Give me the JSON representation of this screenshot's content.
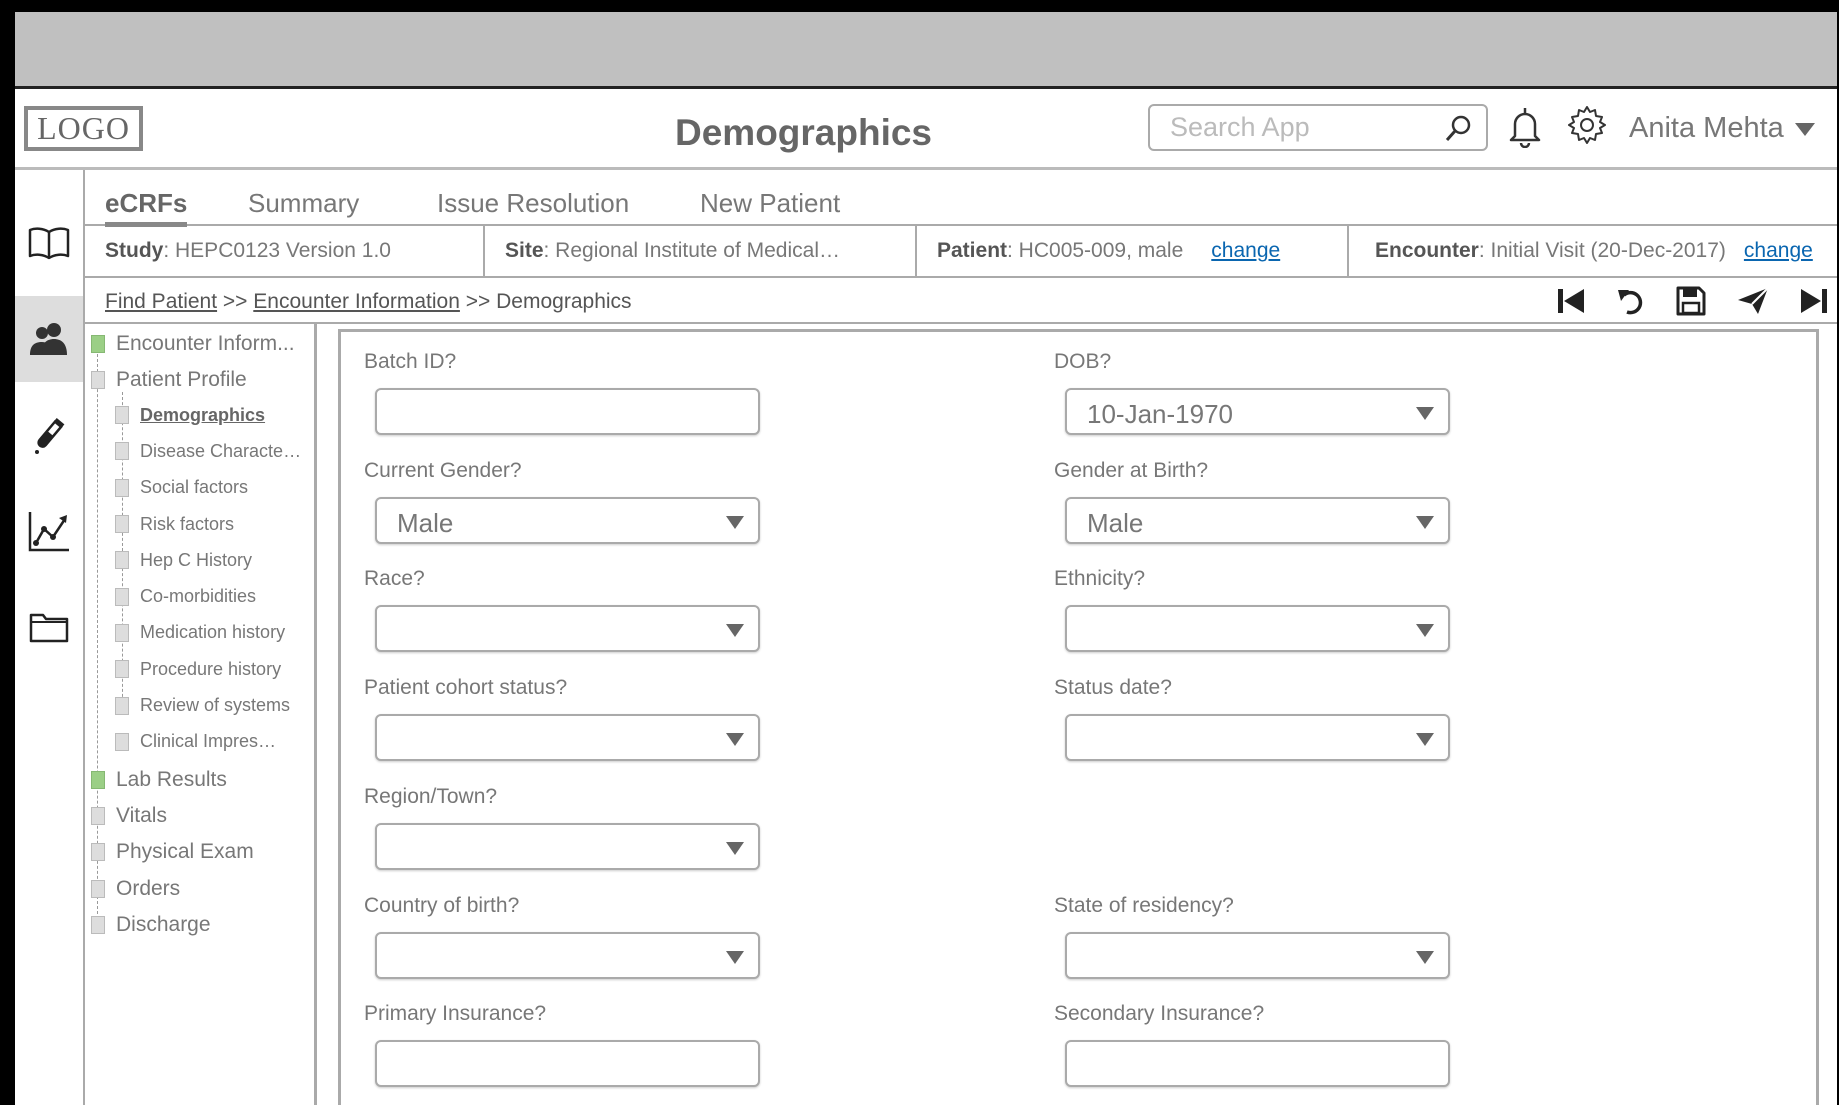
{
  "header": {
    "logo": "LOGO",
    "title": "Demographics",
    "search_placeholder": "Search App",
    "user_name": "Anita Mehta"
  },
  "rail": {
    "items": [
      "book-icon",
      "users-icon",
      "lab-flask-icon",
      "chart-icon",
      "folder-icon"
    ],
    "active": 1
  },
  "tabs": [
    {
      "label": "eCRFs",
      "active": true
    },
    {
      "label": "Summary",
      "active": false
    },
    {
      "label": "Issue Resolution",
      "active": false
    },
    {
      "label": "New Patient",
      "active": false
    }
  ],
  "context": {
    "study_label": "Study",
    "study_value": ": HEPC0123 Version 1.0",
    "site_label": "Site",
    "site_value": ": Regional Institute of Medical…",
    "patient_label": "Patient",
    "patient_value": ": HC005-009, male",
    "patient_change": "change",
    "encounter_label": "Encounter",
    "encounter_value": ": Initial Visit (20-Dec-2017)",
    "encounter_change": "change"
  },
  "breadcrumb": {
    "items": [
      "Find Patient",
      "Encounter Information",
      "Demographics"
    ],
    "separator": ">>"
  },
  "toolbar": [
    "skip-first-icon",
    "undo-icon",
    "save-icon",
    "send-icon",
    "skip-last-icon"
  ],
  "tree": {
    "items": [
      {
        "label": "Encounter Inform...",
        "level": 1,
        "status": "done"
      },
      {
        "label": "Patient Profile",
        "level": 1,
        "status": "none"
      },
      {
        "label": "Demographics",
        "level": 2,
        "status": "none",
        "current": true
      },
      {
        "label": "Disease Characte…",
        "level": 2,
        "status": "none"
      },
      {
        "label": "Social factors",
        "level": 2,
        "status": "none"
      },
      {
        "label": "Risk factors",
        "level": 2,
        "status": "none"
      },
      {
        "label": "Hep C History",
        "level": 2,
        "status": "none"
      },
      {
        "label": "Co-morbidities",
        "level": 2,
        "status": "none"
      },
      {
        "label": "Medication history",
        "level": 2,
        "status": "none"
      },
      {
        "label": "Procedure history",
        "level": 2,
        "status": "none"
      },
      {
        "label": "Review of systems",
        "level": 2,
        "status": "none"
      },
      {
        "label": "Clinical Impres…",
        "level": 2,
        "status": "none"
      },
      {
        "label": "Lab Results",
        "level": 1,
        "status": "done"
      },
      {
        "label": "Vitals",
        "level": 1,
        "status": "none"
      },
      {
        "label": "Physical Exam",
        "level": 1,
        "status": "none"
      },
      {
        "label": "Orders",
        "level": 1,
        "status": "none"
      },
      {
        "label": "Discharge",
        "level": 1,
        "status": "none"
      }
    ]
  },
  "form": {
    "fields": [
      {
        "id": "batch-id",
        "label": "Batch ID?",
        "type": "text",
        "value": ""
      },
      {
        "id": "dob",
        "label": "DOB?",
        "type": "select",
        "value": "10-Jan-1970"
      },
      {
        "id": "current-gender",
        "label": "Current Gender?",
        "type": "select",
        "value": "Male"
      },
      {
        "id": "gender-at-birth",
        "label": "Gender at Birth?",
        "type": "select",
        "value": "Male"
      },
      {
        "id": "race",
        "label": "Race?",
        "type": "select",
        "value": ""
      },
      {
        "id": "ethnicity",
        "label": "Ethnicity?",
        "type": "select",
        "value": ""
      },
      {
        "id": "patient-cohort-status",
        "label": "Patient cohort status?",
        "type": "select",
        "value": ""
      },
      {
        "id": "status-date",
        "label": "Status date?",
        "type": "select",
        "value": ""
      },
      {
        "id": "region-town",
        "label": "Region/Town?",
        "type": "select",
        "value": ""
      },
      {
        "id": "country-of-birth",
        "label": "Country of birth?",
        "type": "select",
        "value": ""
      },
      {
        "id": "state-of-residency",
        "label": "State of residency?",
        "type": "select",
        "value": ""
      },
      {
        "id": "primary-insurance",
        "label": "Primary Insurance?",
        "type": "text",
        "value": ""
      },
      {
        "id": "secondary-insurance",
        "label": "Secondary Insurance?",
        "type": "text",
        "value": ""
      }
    ]
  }
}
